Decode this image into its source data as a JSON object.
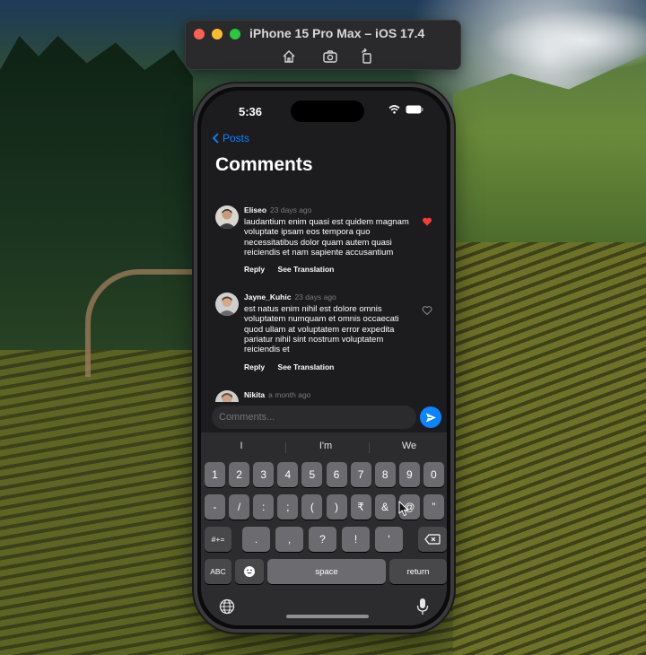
{
  "simulator": {
    "title": "iPhone 15 Pro Max – iOS 17.4",
    "icons": [
      "home-icon",
      "screenshot-icon",
      "rotate-icon"
    ]
  },
  "status_bar": {
    "time": "5:36"
  },
  "nav": {
    "back_label": "Posts",
    "title": "Comments"
  },
  "comments": [
    {
      "author": "Eliseo",
      "time": "23 days ago",
      "text": "laudantium enim quasi est quidem magnam voluptate ipsam eos tempora quo necessitatibus dolor quam autem quasi reiciendis et nam sapiente accusantium",
      "liked": true
    },
    {
      "author": "Jayne_Kuhic",
      "time": "23 days ago",
      "text": "est natus enim nihil est dolore omnis voluptatem numquam et omnis occaecati quod ullam at voluptatem error expedita pariatur nihil sint nostrum voluptatem reiciendis et",
      "liked": false
    },
    {
      "author": "Nikita",
      "time": "a month ago"
    }
  ],
  "comment_actions": {
    "reply": "Reply",
    "translate": "See Translation"
  },
  "input": {
    "placeholder": "Comments..."
  },
  "keyboard": {
    "suggestions": [
      "I",
      "I'm",
      "We"
    ],
    "row1": [
      "1",
      "2",
      "3",
      "4",
      "5",
      "6",
      "7",
      "8",
      "9",
      "0"
    ],
    "row2": [
      "-",
      "/",
      ":",
      ";",
      "(",
      ")",
      "₹",
      "&",
      "@",
      "”"
    ],
    "row3": [
      ".",
      ",",
      "?",
      "!",
      "'"
    ],
    "symbols_key": "#+=",
    "abc_key": "ABC",
    "space_key": "space",
    "return_key": "return"
  },
  "colors": {
    "accent": "#0a84ff",
    "like": "#ff3b30"
  }
}
